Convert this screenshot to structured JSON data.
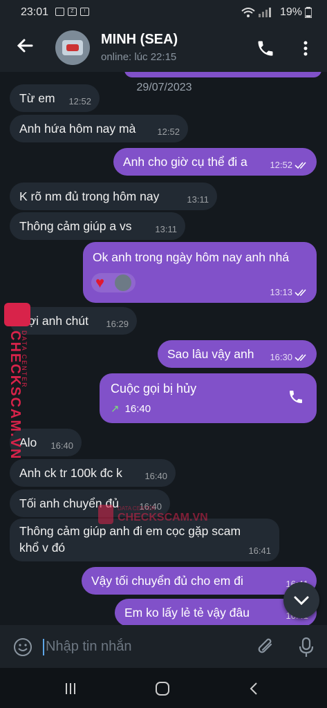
{
  "status_bar": {
    "time": "23:01",
    "battery": "19%"
  },
  "contact": {
    "name": "MINH (SEA)",
    "last_seen": "online: lúc 22:15"
  },
  "chat": {
    "date_separator": "29/07/2023",
    "messages": [
      {
        "direction": "in",
        "text": "Từ em",
        "time": "12:52"
      },
      {
        "direction": "in",
        "text": "Anh hứa hôm nay mà",
        "time": "12:52"
      },
      {
        "direction": "out",
        "text": "Anh cho giờ cụ thể đi a",
        "time": "12:52"
      },
      {
        "direction": "in",
        "text": "K rõ nm đủ trong hôm nay",
        "time": "13:11"
      },
      {
        "direction": "in",
        "text": "Thông cảm giúp a vs",
        "time": "13:11"
      },
      {
        "direction": "out",
        "text": "Ok anh trong ngày hôm nay anh nhá",
        "time": "13:13",
        "reactions": [
          "heart",
          "avatar"
        ]
      },
      {
        "direction": "in",
        "text": "Đợi anh chút",
        "time": "16:29"
      },
      {
        "direction": "out",
        "text": "Sao lâu vậy anh",
        "time": "16:30"
      },
      {
        "direction": "out",
        "type": "call",
        "text": "Cuộc gọi bị hủy",
        "time": "16:40"
      },
      {
        "direction": "in",
        "text": "Alo",
        "time": "16:40"
      },
      {
        "direction": "in",
        "text": "Anh ck tr 100k đc k",
        "time": "16:40"
      },
      {
        "direction": "in",
        "text": "Tối anh chuyển đủ",
        "time": "16:40"
      },
      {
        "direction": "in",
        "text_lines": [
          "Thông cảm giúp anh đi em cọc gặp scam",
          "khổ v đó"
        ],
        "time": "16:41"
      },
      {
        "direction": "out",
        "text": "Vậy tối chuyển đủ cho em đi",
        "time": "16:41"
      },
      {
        "direction": "out",
        "text": "Em ko lấy lẻ tẻ vậy đâu",
        "time": "16:41"
      }
    ]
  },
  "watermark": {
    "brand": "CHECKSCAM.VN",
    "tagline": "DATA CENTER"
  },
  "input": {
    "placeholder": "Nhập tin nhắn"
  },
  "colors": {
    "outgoing_bubble": "#8151c9",
    "incoming_bubble": "#222a33",
    "background": "#14191e"
  },
  "icons": [
    "back-arrow-icon",
    "phone-icon",
    "more-vertical-icon",
    "emoji-icon",
    "attach-icon",
    "mic-icon",
    "chevron-down-icon"
  ]
}
